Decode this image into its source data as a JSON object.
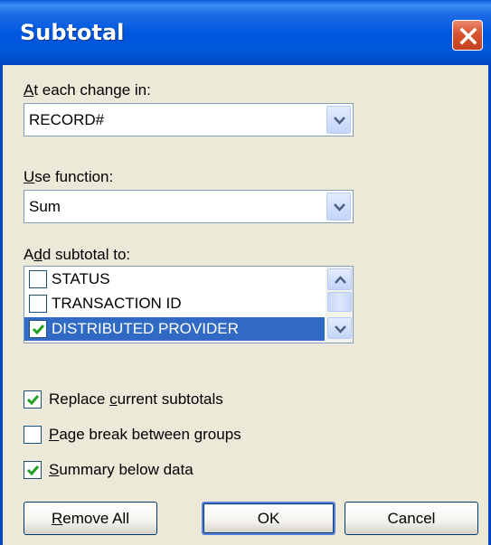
{
  "window": {
    "title": "Subtotal"
  },
  "change": {
    "label_accel": "A",
    "label_rest": "t each change in:",
    "value": "RECORD#"
  },
  "function": {
    "label_accel": "U",
    "label_rest": "se function:",
    "value": "Sum"
  },
  "add_to": {
    "label_pre": "A",
    "label_accel": "d",
    "label_rest": "d subtotal to:",
    "items": [
      {
        "label": "STATUS",
        "checked": false,
        "selected": false
      },
      {
        "label": "TRANSACTION ID",
        "checked": false,
        "selected": false
      },
      {
        "label": "DISTRIBUTED PROVIDER",
        "checked": true,
        "selected": true
      }
    ]
  },
  "options": {
    "replace": {
      "pre": "Replace ",
      "accel": "c",
      "rest": "urrent subtotals",
      "checked": true
    },
    "page_break": {
      "pre": "",
      "accel": "P",
      "rest": "age break between groups",
      "checked": false
    },
    "summary": {
      "pre": "",
      "accel": "S",
      "rest": "ummary below data",
      "checked": true
    }
  },
  "buttons": {
    "remove_all": {
      "accel": "R",
      "rest": "emove All"
    },
    "ok": "OK",
    "cancel": "Cancel"
  },
  "colors": {
    "title_blue": "#0055D8",
    "selection": "#316AC5",
    "dialog_bg": "#ECE9D8",
    "check_green": "#21A121",
    "close_red": "#D8532F"
  }
}
